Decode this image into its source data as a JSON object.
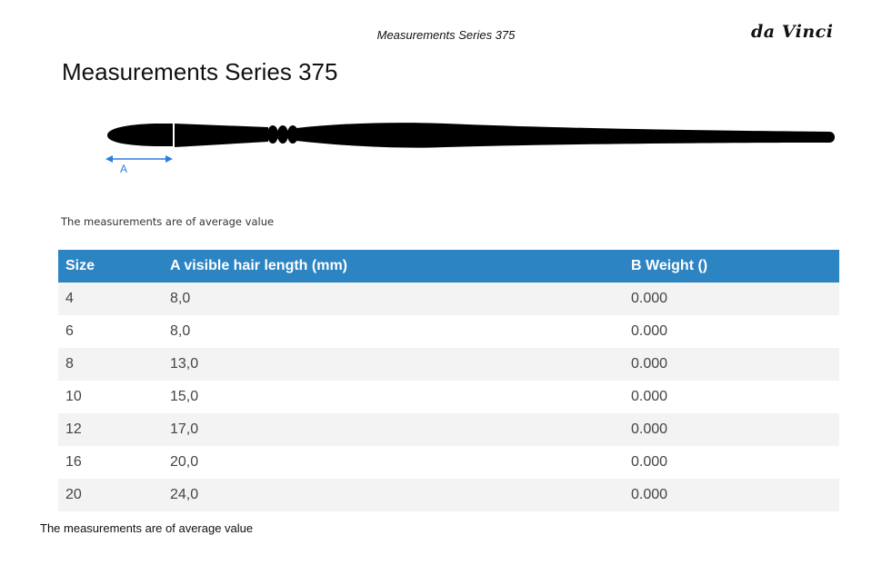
{
  "header": {
    "title": "Measurements Series 375",
    "logo_text": "da Vinci"
  },
  "page_title": "Measurements Series 375",
  "diagram": {
    "dimension_label": "A",
    "arrow_color": "#2b7de0"
  },
  "note_top": "The measurements are of average value",
  "table": {
    "header_color": "#2c84c2",
    "columns": [
      "Size",
      "A visible hair length (mm)",
      "B Weight ()"
    ],
    "rows": [
      [
        "4",
        "8,0",
        "0.000"
      ],
      [
        "6",
        "8,0",
        "0.000"
      ],
      [
        "8",
        "13,0",
        "0.000"
      ],
      [
        "10",
        "15,0",
        "0.000"
      ],
      [
        "12",
        "17,0",
        "0.000"
      ],
      [
        "16",
        "20,0",
        "0.000"
      ],
      [
        "20",
        "24,0",
        "0.000"
      ]
    ]
  },
  "note_bottom": "The measurements are of average value"
}
